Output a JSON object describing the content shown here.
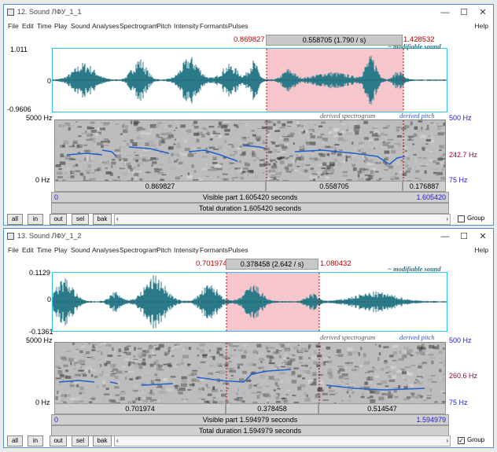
{
  "windows": [
    {
      "title": "12. Sound ЛФУ_1_1",
      "menu": [
        "File",
        "Edit",
        "Time",
        "Play",
        "Sound",
        "Analyses",
        "Spectrogram",
        "Pitch",
        "Intensity",
        "Formants",
        "Pulses"
      ],
      "help": "Help",
      "selection": {
        "start": "0.869827",
        "duration": "0.558705 (1.790 / s)",
        "end": "1.428532"
      },
      "wave": {
        "top": "1.011",
        "zero": "0",
        "bottom": "-0.9606",
        "modifiable": "~ modifiable sound"
      },
      "derived_spectrogram": "derived spectrogram",
      "derived_pitch": "derived pitch",
      "spec": {
        "top_freq": "5000 Hz",
        "bottom_freq": "0 Hz",
        "pitch_top": "500 Hz",
        "pitch_mid": "242.7 Hz",
        "pitch_bottom": "75 Hz"
      },
      "segments": [
        "0.869827",
        "0.558705",
        "0.176887"
      ],
      "visible": {
        "start": "0",
        "label": "Visible part 1.605420 seconds",
        "end": "1.605420"
      },
      "total": "Total duration 1.605420 seconds",
      "buttons": [
        "all",
        "in",
        "out",
        "sel",
        "bak"
      ],
      "group_label": "Group",
      "group_checked": false
    },
    {
      "title": "13. Sound ЛФУ_1_2",
      "menu": [
        "File",
        "Edit",
        "Time",
        "Play",
        "Sound",
        "Analyses",
        "Spectrogram",
        "Pitch",
        "Intensity",
        "Formants",
        "Pulses"
      ],
      "help": "Help",
      "selection": {
        "start": "0.701974",
        "duration": "0.378458 (2.642 / s)",
        "end": "1.080432"
      },
      "wave": {
        "top": "0.1129",
        "zero": "0",
        "bottom": "-0.1361",
        "modifiable": "~ modifiable sound"
      },
      "derived_spectrogram": "derived spectrogram",
      "derived_pitch": "derived pitch",
      "spec": {
        "top_freq": "5000 Hz",
        "bottom_freq": "0 Hz",
        "pitch_top": "500 Hz",
        "pitch_mid": "260.6 Hz",
        "pitch_bottom": "75 Hz"
      },
      "segments": [
        "0.701974",
        "0.378458",
        "0.514547"
      ],
      "visible": {
        "start": "0",
        "label": "Visible part 1.594979 seconds",
        "end": "1.594979"
      },
      "total": "Total duration 1.594979 seconds",
      "buttons": [
        "all",
        "in",
        "out",
        "sel",
        "bak"
      ],
      "group_label": "Group",
      "group_checked": true
    }
  ],
  "colors": {
    "waveform": "#2b7a8a",
    "selection": "#f5c6cc",
    "pitch": "#1f5fd0",
    "cursor": "#c00000"
  },
  "icons": {
    "window": "sound-window-icon",
    "minimize": "minimize-icon",
    "maximize": "maximize-icon",
    "close": "close-icon",
    "check": "check-icon"
  },
  "window_controls": {
    "minimize": "—",
    "maximize": "☐",
    "close": "✕"
  },
  "check_mark": "✓"
}
